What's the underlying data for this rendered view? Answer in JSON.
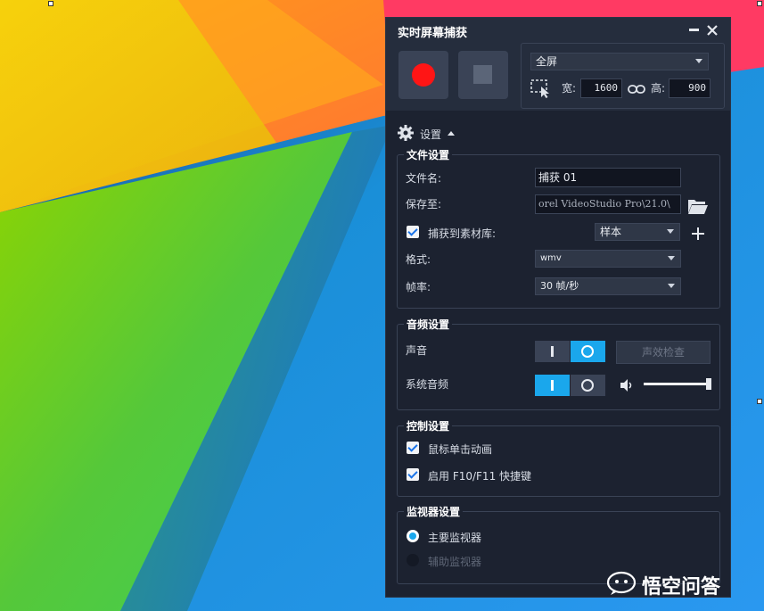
{
  "window": {
    "title": "实时屏幕捕获",
    "minimize_icon": "minimize-icon",
    "close_icon": "close-icon"
  },
  "capture": {
    "area_option": "全屏",
    "width_label": "宽:",
    "width_value": "1600",
    "height_label": "高:",
    "height_value": "900"
  },
  "settings_toggle": {
    "label": "设置",
    "icon": "gear-icon"
  },
  "file_settings": {
    "title": "文件设置",
    "filename_label": "文件名:",
    "filename_value": "捕获 01",
    "save_to_label": "保存至:",
    "save_to_value": "orel VideoStudio Pro\\21.0\\",
    "capture_to_library_label": "捕获到素材库:",
    "capture_to_library_checked": true,
    "library_option": "样本",
    "format_label": "格式:",
    "format_value": "wmv",
    "framerate_label": "帧率:",
    "framerate_value": "30 帧/秒"
  },
  "audio_settings": {
    "title": "音频设置",
    "voice_label": "声音",
    "voice_on": true,
    "sound_check_label": "声效检查",
    "system_audio_label": "系统音频",
    "system_audio_on": false,
    "volume_level": 1.0
  },
  "control_settings": {
    "title": "控制设置",
    "mouse_click_label": "鼠标单击动画",
    "mouse_click_checked": true,
    "hotkey_label": "启用 F10/F11 快捷键",
    "hotkey_checked": true
  },
  "monitor_settings": {
    "title": "监视器设置",
    "primary_label": "主要监视器",
    "primary_selected": true,
    "secondary_label": "辅助监视器",
    "secondary_selected": false
  },
  "watermark": {
    "text": "悟空问答"
  },
  "colors": {
    "accent": "#1aa7ec",
    "record": "#ff1515",
    "panel_bg": "#1c2230"
  }
}
